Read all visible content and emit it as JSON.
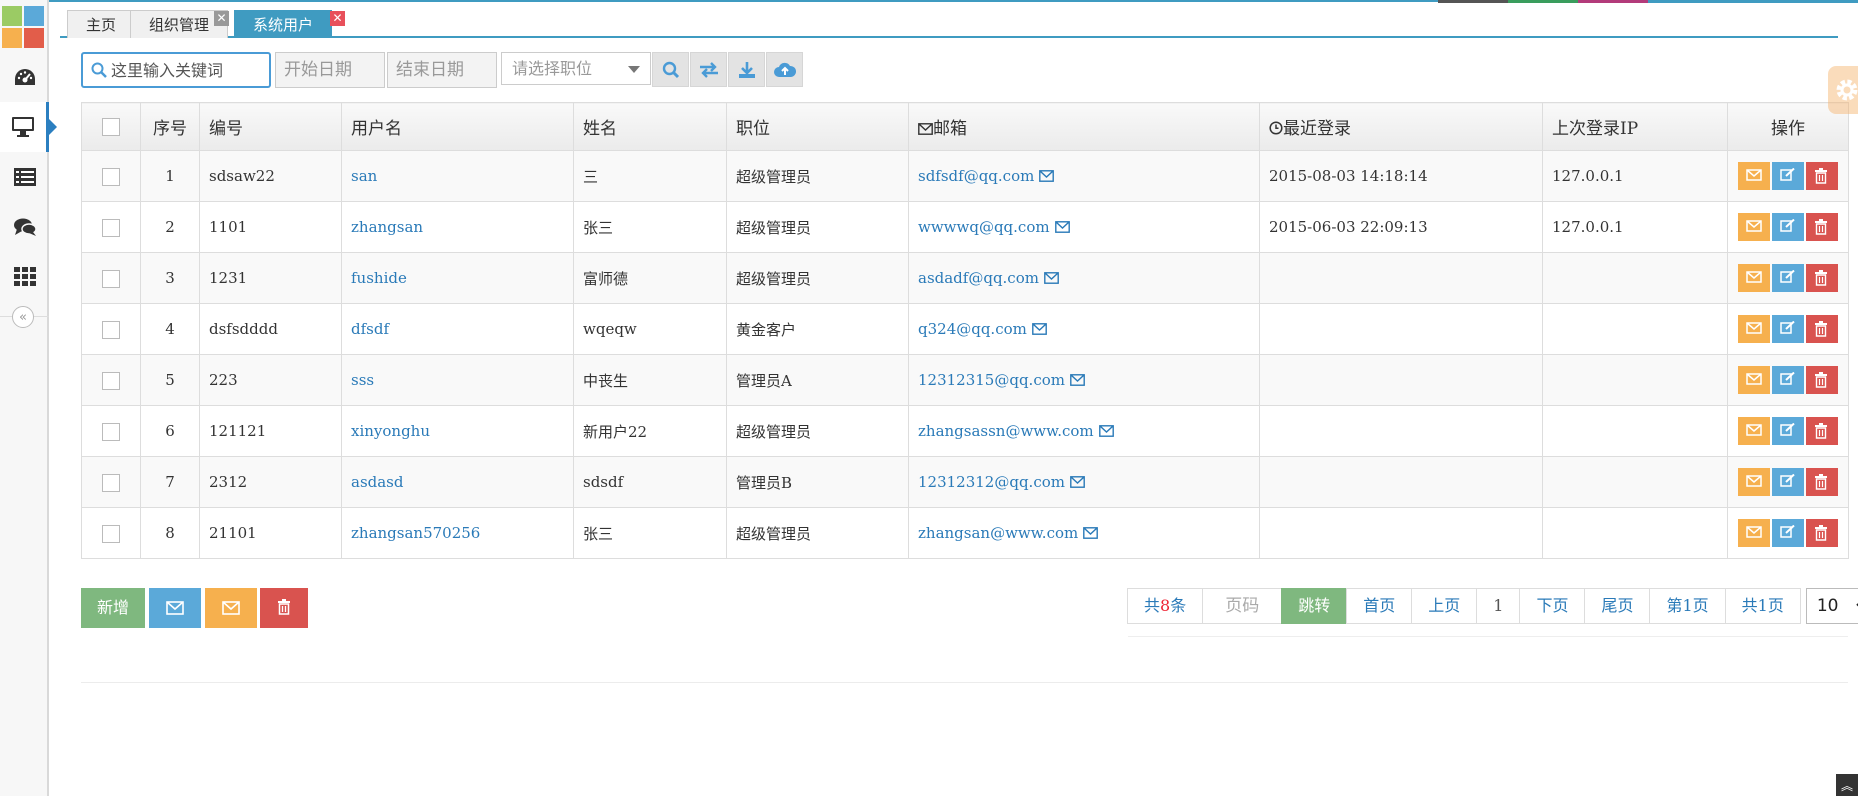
{
  "colors": {
    "accent": "#3f9bc1",
    "link": "#2a7ab8",
    "btn_green": "#7fb87f",
    "btn_blue": "#5ba9d9",
    "btn_orange": "#f6b04e",
    "btn_red": "#d9534f"
  },
  "sidebar": {
    "items": [
      {
        "icon": "dashboard-icon"
      },
      {
        "icon": "monitor-icon",
        "active": true
      },
      {
        "icon": "list-icon"
      },
      {
        "icon": "comments-icon"
      },
      {
        "icon": "grid-icon"
      }
    ],
    "collapse_glyph": "«"
  },
  "tabs": [
    {
      "label": "主页"
    },
    {
      "label": "组织管理",
      "close": "✕"
    },
    {
      "label": "系统用户",
      "close": "✕",
      "active": true
    }
  ],
  "toolbar": {
    "search_placeholder": "这里输入关键词",
    "start_date_placeholder": "开始日期",
    "end_date_placeholder": "结束日期",
    "position_select": "请选择职位",
    "buttons": [
      "search-icon",
      "exchange-icon",
      "download-icon",
      "cloud-upload-icon"
    ]
  },
  "table": {
    "headers": {
      "seq": "序号",
      "code": "编号",
      "username": "用户名",
      "name": "姓名",
      "position": "职位",
      "email": "邮箱",
      "last_login": "最近登录",
      "last_ip": "上次登录IP",
      "op": "操作"
    },
    "rows": [
      {
        "seq": "1",
        "code": "sdsaw22",
        "username": "san",
        "name": "三",
        "position": "超级管理员",
        "email": "sdfsdf@qq.com",
        "last_login": "2015-08-03 14:18:14",
        "last_ip": "127.0.0.1"
      },
      {
        "seq": "2",
        "code": "1101",
        "username": "zhangsan",
        "name": "张三",
        "position": "超级管理员",
        "email": "wwwwq@qq.com",
        "last_login": "2015-06-03 22:09:13",
        "last_ip": "127.0.0.1"
      },
      {
        "seq": "3",
        "code": "1231",
        "username": "fushide",
        "name": "富师德",
        "position": "超级管理员",
        "email": "asdadf@qq.com",
        "last_login": "",
        "last_ip": ""
      },
      {
        "seq": "4",
        "code": "dsfsdddd",
        "username": "dfsdf",
        "name": "wqeqw",
        "position": "黄金客户",
        "email": "q324@qq.com",
        "last_login": "",
        "last_ip": ""
      },
      {
        "seq": "5",
        "code": "223",
        "username": "sss",
        "name": "中丧生",
        "position": "管理员A",
        "email": "12312315@qq.com",
        "last_login": "",
        "last_ip": ""
      },
      {
        "seq": "6",
        "code": "121121",
        "username": "xinyonghu",
        "name": "新用户22",
        "position": "超级管理员",
        "email": "zhangsassn@www.com",
        "last_login": "",
        "last_ip": ""
      },
      {
        "seq": "7",
        "code": "2312",
        "username": "asdasd",
        "name": "sdsdf",
        "position": "管理员B",
        "email": "12312312@qq.com",
        "last_login": "",
        "last_ip": ""
      },
      {
        "seq": "8",
        "code": "21101",
        "username": "zhangsan570256",
        "name": "张三",
        "position": "超级管理员",
        "email": "zhangsan@www.com",
        "last_login": "",
        "last_ip": ""
      }
    ]
  },
  "bottom": {
    "add_label": "新增",
    "icons": [
      "envelope-icon",
      "envelope-open-icon",
      "trash-icon"
    ]
  },
  "pager": {
    "total_prefix": "共",
    "total_count": "8",
    "total_suffix": "条",
    "page_input_placeholder": "页码",
    "go_label": "跳转",
    "first_label": "首页",
    "prev_label": "上页",
    "current_page": "1",
    "next_label": "下页",
    "last_label": "尾页",
    "page_of": "第1页",
    "pages_total": "共1页",
    "page_size": "10"
  }
}
